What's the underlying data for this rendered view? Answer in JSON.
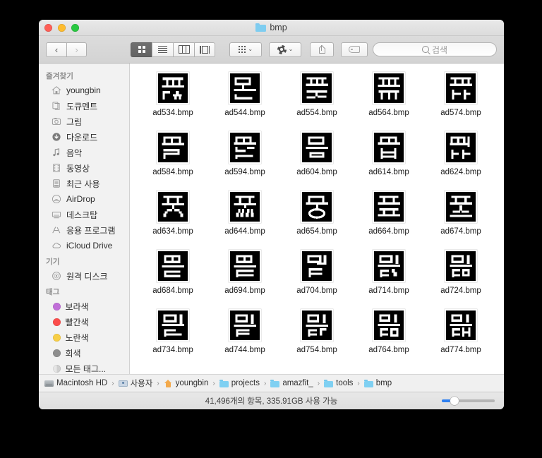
{
  "window": {
    "title": "bmp",
    "title_icon": "folder-icon",
    "traffic_lights": [
      {
        "name": "close",
        "color": "#ff5f57"
      },
      {
        "name": "minimize",
        "color": "#febc2e"
      },
      {
        "name": "maximize",
        "color": "#28c840"
      }
    ]
  },
  "toolbar": {
    "back_label": "‹",
    "forward_label": "›",
    "view_buttons": [
      {
        "name": "icon-view",
        "active": true
      },
      {
        "name": "list-view",
        "active": false
      },
      {
        "name": "column-view",
        "active": false
      },
      {
        "name": "gallery-view",
        "active": false
      }
    ],
    "arrange_chevron": "⌄",
    "action_chevron": "⌄",
    "search": {
      "placeholder": "검색",
      "value": ""
    }
  },
  "sidebar": {
    "sections": [
      {
        "header": "즐겨찾기",
        "items": [
          {
            "label": "youngbin",
            "icon": "home-icon"
          },
          {
            "label": "도큐멘트",
            "icon": "documents-icon"
          },
          {
            "label": "그림",
            "icon": "pictures-icon"
          },
          {
            "label": "다운로드",
            "icon": "downloads-icon"
          },
          {
            "label": "음악",
            "icon": "music-icon"
          },
          {
            "label": "동영상",
            "icon": "movies-icon"
          },
          {
            "label": "최근 사용",
            "icon": "recents-icon"
          },
          {
            "label": "AirDrop",
            "icon": "airdrop-icon"
          },
          {
            "label": "데스크탑",
            "icon": "desktop-icon"
          },
          {
            "label": "응용 프로그램",
            "icon": "applications-icon"
          },
          {
            "label": "iCloud Drive",
            "icon": "icloud-icon"
          }
        ]
      },
      {
        "header": "기기",
        "items": [
          {
            "label": "원격 디스크",
            "icon": "remote-disc-icon"
          }
        ]
      },
      {
        "header": "태그",
        "items": [
          {
            "label": "보라색",
            "icon": "tag-dot-icon",
            "color": "#c06ed8"
          },
          {
            "label": "빨간색",
            "icon": "tag-dot-icon",
            "color": "#fb4d4b"
          },
          {
            "label": "노란색",
            "icon": "tag-dot-icon",
            "color": "#f7ce46"
          },
          {
            "label": "회색",
            "icon": "tag-dot-icon",
            "color": "#8e8e8e"
          },
          {
            "label": "모든 태그...",
            "icon": "all-tags-icon",
            "color": "#dcdcdc"
          }
        ]
      }
    ]
  },
  "files": [
    {
      "name": "ad534.bmp"
    },
    {
      "name": "ad544.bmp"
    },
    {
      "name": "ad554.bmp"
    },
    {
      "name": "ad564.bmp"
    },
    {
      "name": "ad574.bmp"
    },
    {
      "name": "ad584.bmp"
    },
    {
      "name": "ad594.bmp"
    },
    {
      "name": "ad604.bmp"
    },
    {
      "name": "ad614.bmp"
    },
    {
      "name": "ad624.bmp"
    },
    {
      "name": "ad634.bmp"
    },
    {
      "name": "ad644.bmp"
    },
    {
      "name": "ad654.bmp"
    },
    {
      "name": "ad664.bmp"
    },
    {
      "name": "ad674.bmp"
    },
    {
      "name": "ad684.bmp"
    },
    {
      "name": "ad694.bmp"
    },
    {
      "name": "ad704.bmp"
    },
    {
      "name": "ad714.bmp"
    },
    {
      "name": "ad724.bmp"
    },
    {
      "name": "ad734.bmp"
    },
    {
      "name": "ad744.bmp"
    },
    {
      "name": "ad754.bmp"
    },
    {
      "name": "ad764.bmp"
    },
    {
      "name": "ad774.bmp"
    }
  ],
  "pathbar": {
    "crumbs": [
      {
        "label": "Macintosh HD",
        "icon": "hard-disk-icon"
      },
      {
        "label": "사용자",
        "icon": "users-folder-icon"
      },
      {
        "label": "youngbin",
        "icon": "home-folder-icon"
      },
      {
        "label": "projects",
        "icon": "folder-icon"
      },
      {
        "label": "amazfit_",
        "icon": "folder-icon"
      },
      {
        "label": "tools",
        "icon": "folder-icon"
      },
      {
        "label": "bmp",
        "icon": "folder-icon"
      }
    ],
    "separator": "›"
  },
  "statusbar": {
    "text": "41,496개의 항목, 335.91GB 사용 가능",
    "zoom_slider": {
      "value": 16,
      "min": 0,
      "max": 100
    }
  }
}
